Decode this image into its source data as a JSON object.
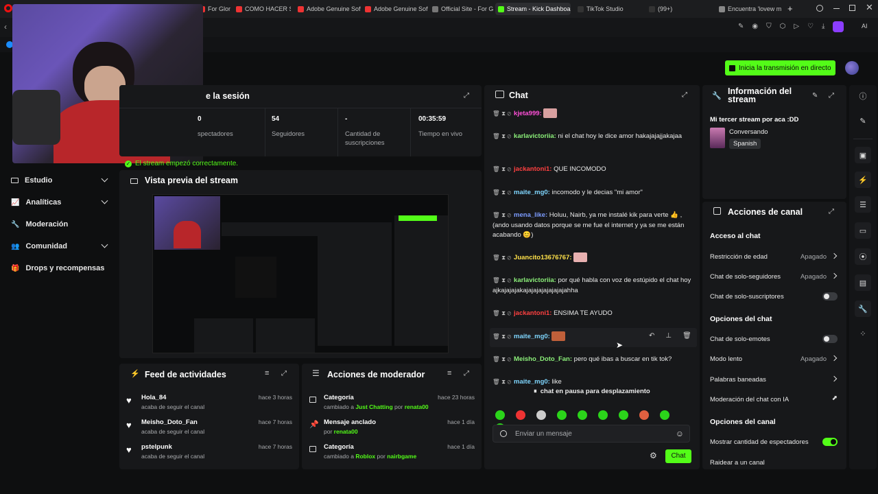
{
  "browser": {
    "tabs": [
      {
        "label": "For Glor",
        "color": "#e33"
      },
      {
        "label": "COMO HACER STR",
        "color": "#e33"
      },
      {
        "label": "Adobe Genuine Softw",
        "color": "#e33"
      },
      {
        "label": "Adobe Genuine Softw",
        "color": "#e33"
      },
      {
        "label": "Official Site - For Glor",
        "color": "#777"
      },
      {
        "label": "Stream - Kick Dashboard",
        "color": "#53fc18"
      },
      {
        "label": "TikTok Studio",
        "color": "#111"
      },
      {
        "label": "(99+)",
        "color": "#111"
      },
      {
        "label": "Encuentra 'lovew m",
        "color": "#888"
      }
    ],
    "new_tab": "+"
  },
  "header": {
    "go_live_label": "Inicia la transmisión en directo"
  },
  "session": {
    "title": "e la sesión",
    "stats": [
      {
        "value": "0",
        "label": "spectadores"
      },
      {
        "value": "54",
        "label": "Seguidores"
      },
      {
        "value": "-",
        "label": "Cantidad de suscripciones"
      },
      {
        "value": "00:35:59",
        "label": "Tiempo en vivo"
      }
    ],
    "status": "El stream empezó correctamente."
  },
  "sidebar": {
    "items": [
      {
        "label": "Estudio",
        "icon": "tv-icon",
        "chevron": true
      },
      {
        "label": "Analíticas",
        "icon": "chart-icon",
        "chevron": true
      },
      {
        "label": "Moderación",
        "icon": "wrench-icon",
        "chevron": false
      },
      {
        "label": "Comunidad",
        "icon": "users-icon",
        "chevron": true
      },
      {
        "label": "Drops y recompensas",
        "icon": "gift-icon",
        "chevron": false
      }
    ]
  },
  "preview": {
    "title": "Vista previa del stream"
  },
  "activity_feed": {
    "title": "Feed de actividades",
    "items": [
      {
        "name": "Hola_84",
        "action": "acaba de seguir el canal",
        "time": "hace 3 horas"
      },
      {
        "name": "Meisho_Doto_Fan",
        "action": "acaba de seguir el canal",
        "time": "hace 7 horas"
      },
      {
        "name": "pstelpunk",
        "action": "acaba de seguir el canal",
        "time": "hace 7 horas"
      }
    ]
  },
  "mod_actions": {
    "title": "Acciones de moderador",
    "items": [
      {
        "title": "Categoría",
        "pre": "cambiado a",
        "target": "Just Chatting",
        "mid": "por",
        "by": "renata00",
        "time": "hace 23 horas"
      },
      {
        "title": "Mensaje anclado",
        "pre": "",
        "target": "",
        "mid": "por",
        "by": "renata00",
        "time": "hace 1 día"
      },
      {
        "title": "Categoría",
        "pre": "cambiado a",
        "target": "Roblox",
        "mid": "por",
        "by": "nairbgame",
        "time": "hace 1 día"
      }
    ]
  },
  "chat": {
    "title": "Chat",
    "messages": [
      {
        "user": "kjeta999:",
        "color": "#ff4fd8",
        "text": ""
      },
      {
        "user": "karlavictoriia:",
        "color": "#8cf07a",
        "text": " ni el chat hoy le dice amor hakajajajjakajaa"
      },
      {
        "user": "jackantoni1:",
        "color": "#ff4040",
        "text": " QUE INCOMODO"
      },
      {
        "user": "maite_mg0:",
        "color": "#7fd6ff",
        "text": " incomodo y le decias \"mi amor\""
      },
      {
        "user": "mena_like:",
        "color": "#7c9cff",
        "text": " Holuu, Nairb, ya me instalé kik para verte 👍 , (ando usando datos porque se me fue el internet y ya se me están acabando 😊)"
      },
      {
        "user": "Juancito13676767:",
        "color": "#ffe14a",
        "text": ""
      },
      {
        "user": "karlavictoriia:",
        "color": "#8cf07a",
        "text": " por qué habla con voz de estúpido el chat hoy ajkajajajakajajajajajajajajahha"
      },
      {
        "user": "jackantoni1:",
        "color": "#ff4040",
        "text": " ENSIMA TE AYUDO"
      },
      {
        "user": "maite_mg0:",
        "color": "#7fd6ff",
        "text": ""
      },
      {
        "user": "Meisho_Doto_Fan:",
        "color": "#8cf07a",
        "text": " pero qué ibas a buscar en tik tok?"
      },
      {
        "user": "maite_mg0:",
        "color": "#7fd6ff",
        "text": " like"
      }
    ],
    "paused": "chat en pausa para desplazamiento",
    "input_placeholder": "Enviar un mensaje",
    "send_label": "Chat"
  },
  "stream_info": {
    "title": "Información del stream",
    "stream_title": "Mi tercer stream por aca :DD",
    "category": "Conversando",
    "language": "Spanish"
  },
  "channel_actions": {
    "title": "Acciones de canal",
    "sections": [
      {
        "title": "Acceso al chat",
        "rows": [
          {
            "label": "Restricción de edad",
            "value": "Apagado",
            "kind": "arrow"
          },
          {
            "label": "Chat de solo-seguidores",
            "value": "Apagado",
            "kind": "arrow"
          },
          {
            "label": "Chat de solo-suscriptores",
            "value": "",
            "kind": "toggle-off"
          }
        ]
      },
      {
        "title": "Opciones del chat",
        "rows": [
          {
            "label": "Chat de solo-emotes",
            "value": "",
            "kind": "toggle-off"
          },
          {
            "label": "Modo lento",
            "value": "Apagado",
            "kind": "arrow"
          },
          {
            "label": "Palabras baneadas",
            "value": "",
            "kind": "arrow"
          },
          {
            "label": "Moderación del chat con IA",
            "value": "",
            "kind": "external"
          }
        ]
      },
      {
        "title": "Opciones del canal",
        "rows": [
          {
            "label": "Mostrar cantidad de espectadores",
            "value": "",
            "kind": "toggle-on"
          },
          {
            "label": "Raidear a un canal",
            "value": "",
            "kind": "none"
          }
        ]
      }
    ]
  },
  "colors": {
    "accent": "#53fc18",
    "panel": "#17181a",
    "bg": "#0e0f10"
  }
}
